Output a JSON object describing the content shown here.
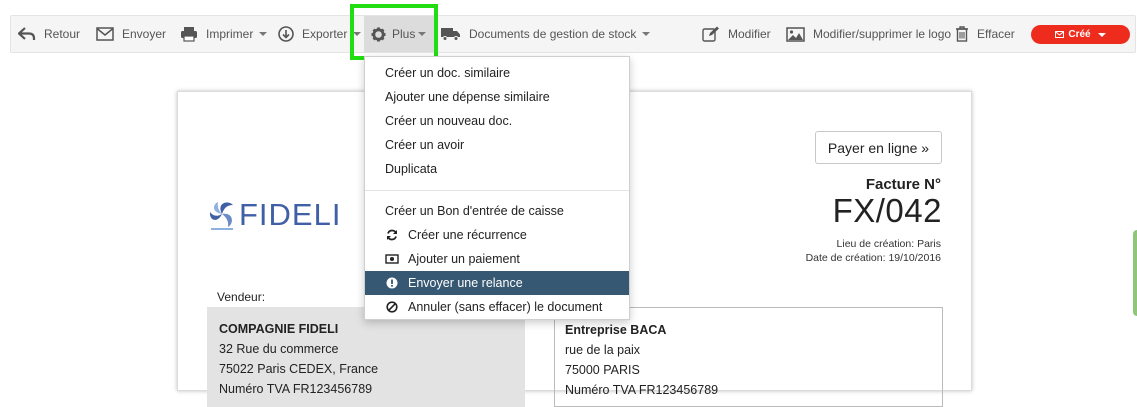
{
  "toolbar": {
    "back_label": "Retour",
    "send_label": "Envoyer",
    "print_label": "Imprimer",
    "export_label": "Exporter",
    "more_label": "Plus",
    "stock_docs_label": "Documents de gestion de stock",
    "edit_label": "Modifier",
    "logo_label": "Modifier/supprimer le logo",
    "delete_label": "Effacer",
    "status_label": "Créé"
  },
  "menu": {
    "group1": [
      "Créer un doc. similaire",
      "Ajouter une dépense similaire",
      "Créer un nouveau doc.",
      "Créer un avoir",
      "Duplicata"
    ],
    "cash_entry": "Créer un Bon d'entrée de caisse",
    "recurrence": "Créer une récurrence",
    "payment": "Ajouter un paiement",
    "reminder": "Envoyer une relance",
    "cancel": "Annuler (sans effacer) le document"
  },
  "document": {
    "pay_online": "Payer en ligne »",
    "invoice_title": "Facture N°",
    "invoice_number": "FX/042",
    "place": "Lieu de création: Paris",
    "date": "Date de création: 19/10/2016",
    "logo_text": "FIDELI",
    "vendor_label": "Vendeur:",
    "vendor": {
      "name": "COMPAGNIE FIDELI",
      "street": "32 Rue du commerce",
      "city": "75022 Paris CEDEX, France",
      "vat": "Numéro TVA FR123456789"
    },
    "client": {
      "name": "Entreprise BACA",
      "street": "rue de la paix",
      "city": "75000 PARIS",
      "vat": "Numéro TVA FR123456789"
    }
  },
  "colors": {
    "status": "#ee2c1e",
    "menu_active": "#365873",
    "highlight": "#22dd11",
    "logo": "#3f5fa6"
  }
}
